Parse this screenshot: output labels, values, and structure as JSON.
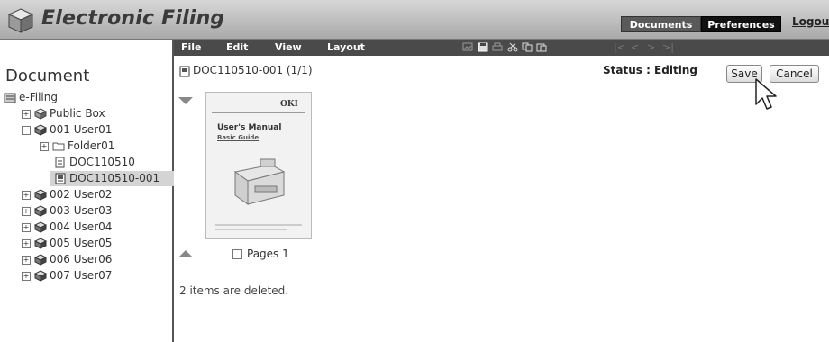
{
  "app": {
    "title": "Electronic Filing"
  },
  "header_tabs": {
    "documents": "Documents",
    "preferences": "Preferences",
    "logout": "Logout"
  },
  "menu": [
    "File",
    "Edit",
    "View",
    "Layout"
  ],
  "toolbar_icons": [
    "image-icon",
    "save-icon",
    "print-icon",
    "cut-icon",
    "copy-icon",
    "paste-icon",
    "first-page-icon",
    "prev-page-icon",
    "next-page-icon",
    "last-page-icon"
  ],
  "panel": {
    "title": "Document"
  },
  "tree": [
    {
      "label": "e-Filing",
      "icon": "efiling-icon",
      "expander": ""
    },
    {
      "label": "Public Box",
      "icon": "public-box-icon",
      "expander": "+"
    },
    {
      "label": "001 User01",
      "icon": "user-box-icon",
      "expander": "−"
    },
    {
      "label": "Folder01",
      "icon": "folder-icon",
      "expander": "+"
    },
    {
      "label": "DOC110510",
      "icon": "document-icon",
      "expander": ""
    },
    {
      "label": "DOC110510-001",
      "icon": "document-editing-icon",
      "expander": "",
      "selected": true
    },
    {
      "label": "002 User02",
      "icon": "user-box-icon",
      "expander": "+"
    },
    {
      "label": "003 User03",
      "icon": "user-box-icon",
      "expander": "+"
    },
    {
      "label": "004 User04",
      "icon": "user-box-icon",
      "expander": "+"
    },
    {
      "label": "005 User05",
      "icon": "user-box-icon",
      "expander": "+"
    },
    {
      "label": "006 User06",
      "icon": "user-box-icon",
      "expander": "+"
    },
    {
      "label": "007 User07",
      "icon": "user-box-icon",
      "expander": "+"
    }
  ],
  "document": {
    "title": "DOC110510-001  (1/1)",
    "status": "Status : Editing"
  },
  "buttons": {
    "save": "Save",
    "cancel": "Cancel"
  },
  "thumbnail": {
    "brand": "OKI",
    "heading": "User's Manual",
    "subheading": "Basic Guide"
  },
  "pages_label": "Pages 1",
  "message": "2 items are deleted.",
  "colors": {
    "header_bg": "#b8b8b8",
    "menubar_bg": "#4a4a4a",
    "tab_active": "#111111",
    "selected_row": "#d4d4d4"
  }
}
